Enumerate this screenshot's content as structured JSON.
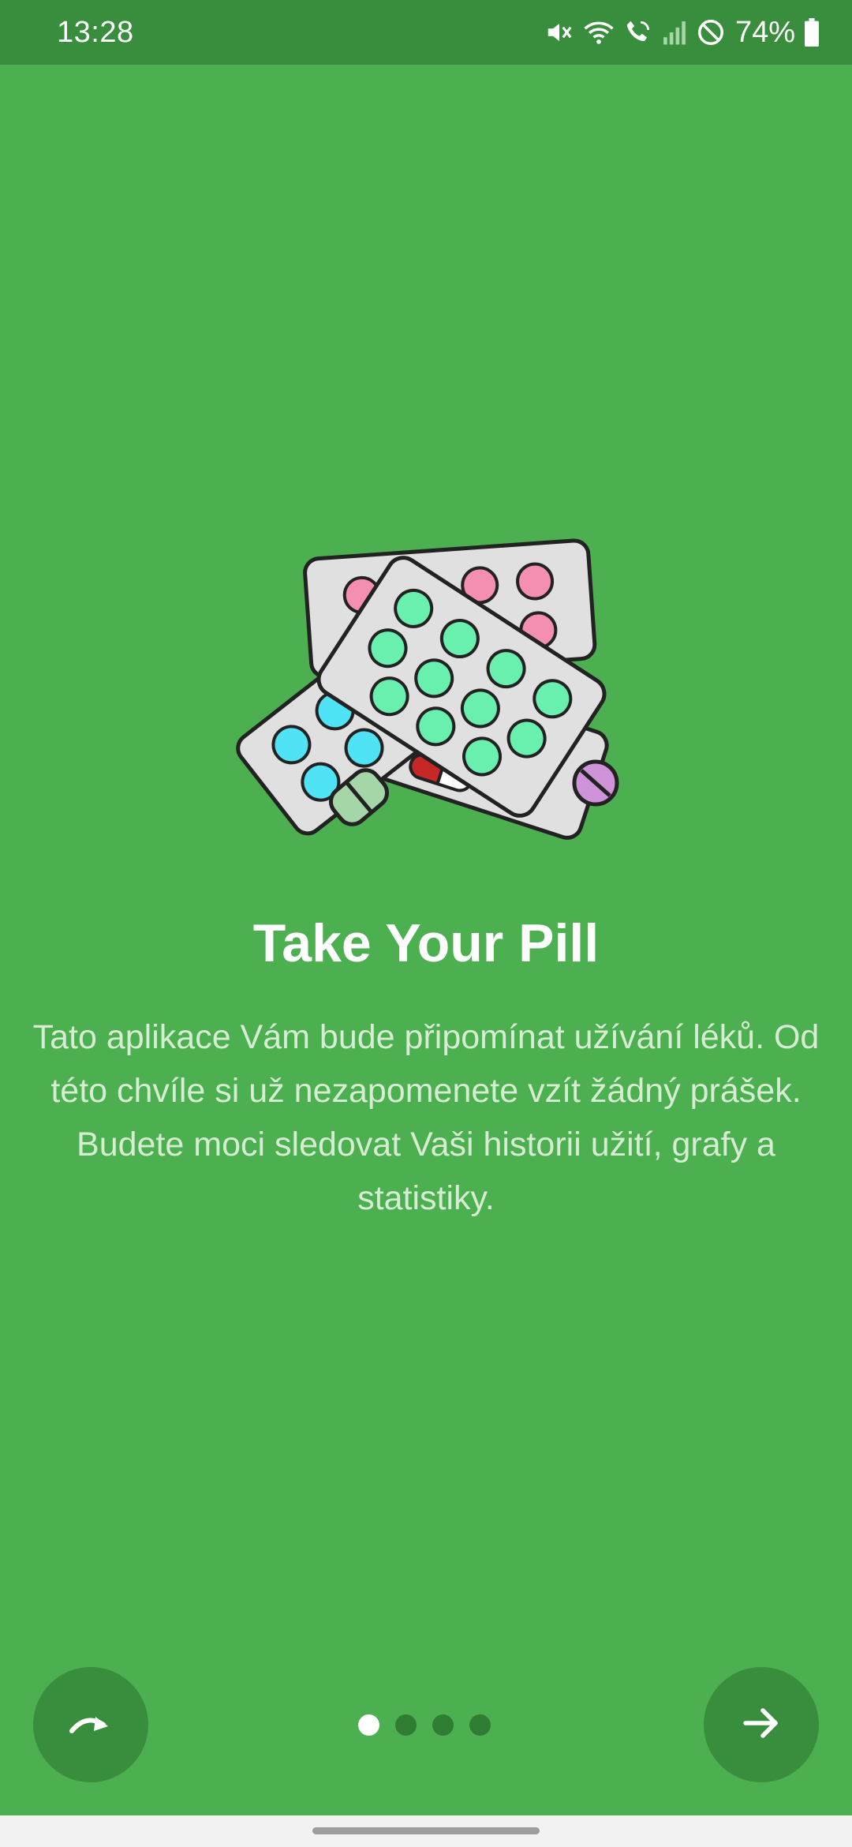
{
  "status_bar": {
    "time": "13:28",
    "battery": "74%",
    "icons": [
      "mute-icon",
      "wifi-icon",
      "wifi-calling-icon",
      "signal-icon",
      "do-not-disturb-icon",
      "battery-icon"
    ]
  },
  "onboarding": {
    "illustration": "pill-blister-packs-illustration",
    "title": "Take Your Pill",
    "description": "Tato aplikace Vám bude připomínat užívání léků. Od této chvíle si už nezapomenete vzít žádný prášek. Budete moci sledovat Vaši historii užití, grafy a statistiky.",
    "page_count": 4,
    "current_page": 1
  },
  "buttons": {
    "skip_icon": "skip-icon",
    "next_icon": "arrow-right-icon"
  },
  "colors": {
    "background": "#4caf50",
    "status_bar": "#388e3c",
    "button": "#388e3c",
    "dot_inactive": "#2e7d32",
    "dot_active": "#ffffff"
  }
}
